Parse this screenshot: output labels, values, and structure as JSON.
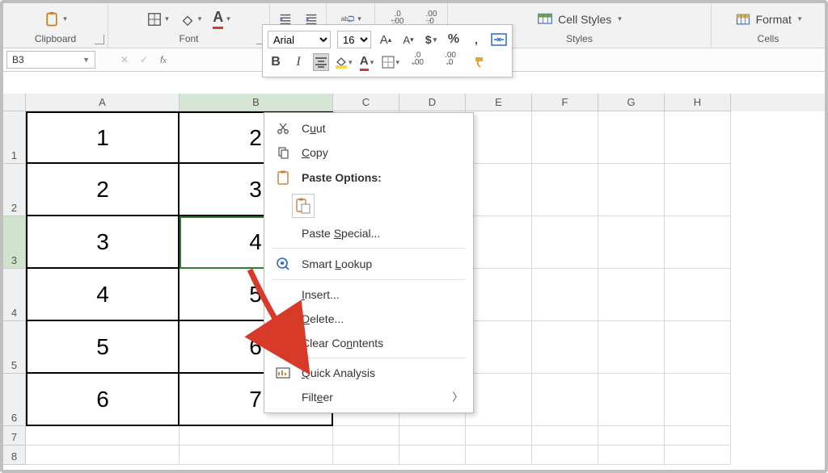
{
  "ribbon": {
    "clipboard": {
      "label": "Clipboard"
    },
    "font": {
      "label": "Font"
    },
    "styles": {
      "label": "Styles",
      "cellStyles": "Cell Styles"
    },
    "cells": {
      "label": "Cells",
      "format": "Format"
    }
  },
  "mini": {
    "fontName": "Arial",
    "fontSize": "16",
    "increaseDec": ".00",
    "decreaseDec": ".00"
  },
  "namebox": {
    "value": "B3"
  },
  "columns": [
    "A",
    "B",
    "C",
    "D",
    "E",
    "F",
    "G",
    "H"
  ],
  "rows": [
    {
      "n": "1",
      "A": "1",
      "B": "2"
    },
    {
      "n": "2",
      "A": "2",
      "B": "3"
    },
    {
      "n": "3",
      "A": "3",
      "B": "4"
    },
    {
      "n": "4",
      "A": "4",
      "B": "5"
    },
    {
      "n": "5",
      "A": "5",
      "B": "6"
    },
    {
      "n": "6",
      "A": "6",
      "B": "7"
    },
    {
      "n": "7"
    },
    {
      "n": "8"
    }
  ],
  "ctx": {
    "cut": "ut",
    "copy": "opy",
    "pasteOptions": "Paste Options:",
    "pasteSpecial": "pecial...",
    "smartLookup": "ookup",
    "insert": "nsert...",
    "delete": "elete...",
    "clear": "ntents",
    "quick": "uick Analysis",
    "filter": "er"
  }
}
